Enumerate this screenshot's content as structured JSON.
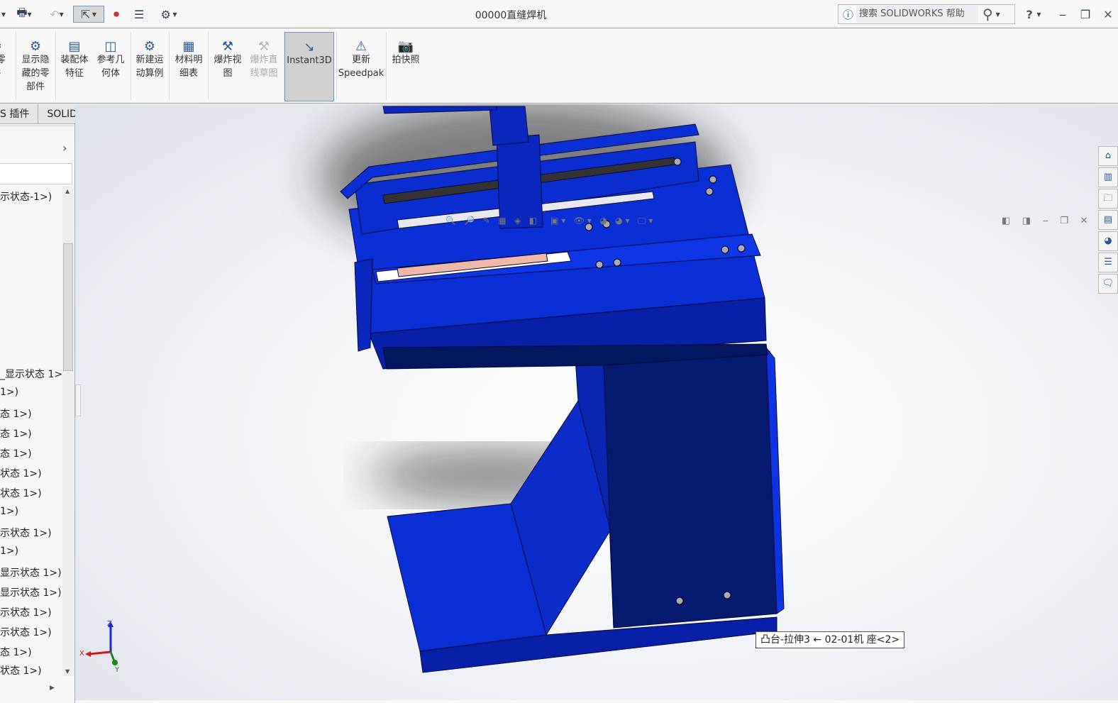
{
  "window": {
    "title": "00000直缝焊机"
  },
  "quick_access": [
    {
      "icon": "print-icon"
    },
    {
      "icon": "undo-icon"
    },
    {
      "icon": "select-cursor-icon"
    },
    {
      "icon": "rebuild-traffic-light-icon"
    },
    {
      "icon": "file-properties-icon"
    },
    {
      "icon": "options-gear-icon"
    }
  ],
  "help_search": {
    "placeholder": "搜索 SOLIDWORKS 帮助",
    "help_label": "?"
  },
  "ribbon": {
    "items": [
      {
        "label": "...零\n件",
        "icon": "component-icon",
        "disabled": false
      },
      {
        "label": "显示隐\n藏的零\n部件",
        "icon": "show-hidden-components-icon",
        "disabled": false
      },
      {
        "label": "装配体\n特征",
        "icon": "assembly-features-icon",
        "disabled": false
      },
      {
        "label": "参考几\n何体",
        "icon": "reference-geometry-icon",
        "disabled": false
      },
      {
        "label": "新建运\n动算例",
        "icon": "new-motion-study-icon",
        "disabled": false
      },
      {
        "label": "材料明\n细表",
        "icon": "bill-of-materials-icon",
        "disabled": false
      },
      {
        "label": "爆炸视\n图",
        "icon": "exploded-view-icon",
        "disabled": false
      },
      {
        "label": "爆炸直\n线草图",
        "icon": "explode-line-sketch-icon",
        "disabled": true
      },
      {
        "label": "Instant3D",
        "icon": "instant3d-icon",
        "disabled": false,
        "active": true
      },
      {
        "label": "更新\nSpeedpak",
        "icon": "update-speedpak-icon",
        "disabled": false
      },
      {
        "label": "拍快照",
        "icon": "snapshot-camera-icon",
        "disabled": false
      }
    ]
  },
  "tabs": [
    {
      "label": "S 插件"
    },
    {
      "label": "SOLIDWORKS MBD"
    }
  ],
  "tree": {
    "items": [
      "示状态-1>)",
      "_显示状态 1>",
      "1>)",
      "态 1>)",
      "态 1>)",
      "态 1>)",
      "状态 1>)",
      "状态 1>)",
      "1>)",
      "示状态 1>)",
      "1>)",
      "显示状态 1>)",
      "显示状态 1>)",
      "示状态 1>)",
      "示状态 1>)",
      "态 1>)",
      "状态 1>)"
    ]
  },
  "viewport": {
    "tooltip": "凸台-拉伸3 ← 02-01机 座<2>",
    "model_color": "#0a2fd6",
    "triad": {
      "x": "X",
      "y": "Y",
      "z": "Z"
    }
  },
  "task_pane": [
    "home-icon",
    "design-library-icon",
    "file-explorer-icon",
    "view-palette-icon",
    "appearances-icon",
    "custom-properties-icon",
    "forum-icon"
  ]
}
